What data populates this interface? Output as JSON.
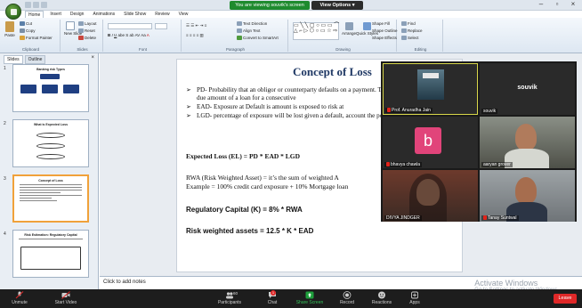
{
  "titlebar": {
    "banner": "You are viewing souvik's screen",
    "view_options": "View Options ▾"
  },
  "ribbon": {
    "tabs": [
      "Home",
      "Insert",
      "Design",
      "Animations",
      "Slide Show",
      "Review",
      "View"
    ],
    "clipboard": {
      "paste": "Paste",
      "cut": "Cut",
      "copy": "Copy",
      "format_painter": "Format Painter",
      "label": "Clipboard"
    },
    "slides": {
      "new_slide": "New Slide",
      "layout": "Layout",
      "reset": "Reset",
      "delete": "Delete",
      "label": "Slides"
    },
    "font": {
      "label": "Font"
    },
    "paragraph": {
      "text_direction": "Text Direction",
      "align_text": "Align Text",
      "convert_smartart": "Convert to SmartArt",
      "label": "Paragraph"
    },
    "drawing": {
      "arrange": "Arrange",
      "quick_styles": "Quick Styles",
      "shape_fill": "Shape Fill",
      "shape_outline": "Shape Outline",
      "shape_effects": "Shape Effects",
      "label": "Drawing"
    },
    "editing": {
      "find": "Find",
      "replace": "Replace",
      "select": "Select",
      "label": "Editing"
    }
  },
  "leftpanel": {
    "tab_slides": "Slides",
    "tab_outline": "Outline",
    "slides": [
      {
        "num": "1",
        "title": "Banking risk Types"
      },
      {
        "num": "2",
        "title": "What is Expected Loss"
      },
      {
        "num": "3",
        "title": "Concept of Loss"
      },
      {
        "num": "4",
        "title": "Risk Estimation: Regulatory Capital"
      }
    ]
  },
  "slide": {
    "title": "Concept of Loss",
    "bullets": [
      "PD- Probability that an obligor or counterparty defaults on a payment. Therefore, being able to pay due amount of a loan for a consecutive",
      "EAD- Exposure at Default is amount is exposed to risk at",
      "LGD- percentage of exposure will be lost given a default, account the post write off recoveries."
    ],
    "el_formula": "Expected Loss (EL) =  PD * EAD * LGD",
    "rwa_line": "RWA (Risk Weighted Asset) =  it’s the sum of weighted A",
    "rwa_example": "Example = 100% credit card exposure + 10% Mortgage loan",
    "reg_capital": "Regulatory Capital (K) = 8% * RWA",
    "risk_weighted": "Risk weighted assets = 12.5 * K * EAD"
  },
  "notes": {
    "placeholder": "Click to add notes"
  },
  "watermark": {
    "line1": "Activate Windows",
    "line2": "Go to Settings to activate Windows."
  },
  "participants_video": [
    {
      "name": "Prof. Anuradha Jain",
      "type": "photo",
      "muted": true
    },
    {
      "name": "souvik",
      "type": "name-only",
      "display": "souvik"
    },
    {
      "name": "bhavya chawla",
      "type": "avatar",
      "initial": "b",
      "avatar_color": "#e1447a",
      "muted": true
    },
    {
      "name": "aaryan grover",
      "type": "camera"
    },
    {
      "name": "DIVYA JINDGER",
      "type": "camera"
    },
    {
      "name": "Tanay Suntwal",
      "type": "camera",
      "muted": true
    }
  ],
  "zoom_toolbar": {
    "unmute": "Unmute",
    "start_video": "Start Video",
    "participants": "Participants",
    "participants_count": "60",
    "chat": "Chat",
    "chat_badge": "1",
    "share_screen": "Share Screen",
    "record": "Record",
    "reactions": "Reactions",
    "apps": "Apps",
    "leave": "Leave"
  },
  "colors": {
    "share_green": "#1e8b2e",
    "leave_red": "#e02828",
    "title_blue": "#1f3864"
  }
}
